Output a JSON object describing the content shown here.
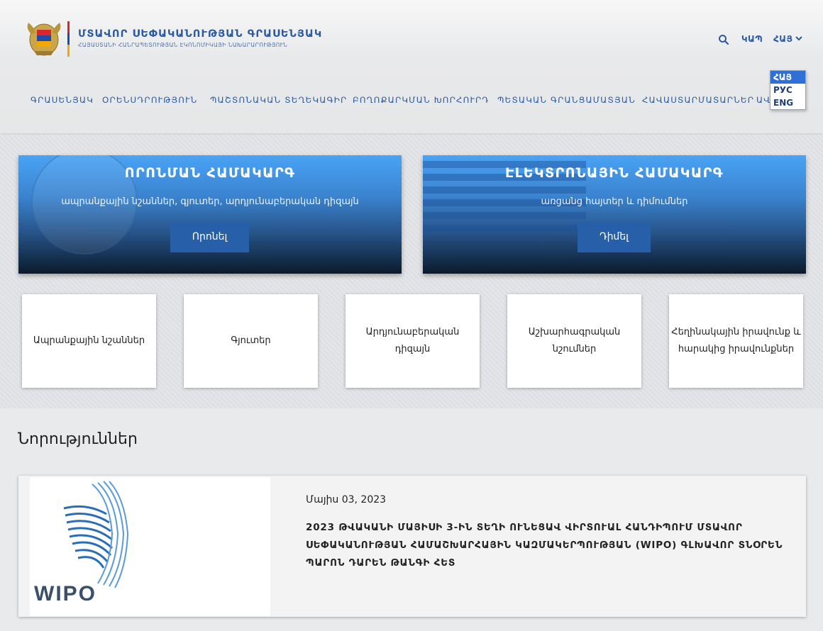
{
  "header": {
    "org_title": "ՄՏԱՎՈՐ ՍԵՓԱԿԱՆՈՒԹՅԱՆ ԳՐԱՍԵՆՅԱԿ",
    "org_subtitle": "ՀԱՅԱՍՏԱՆԻ ՀԱՆՐԱՊԵՏՈՒԹՅԱՆ ԷԿՈՆՈՄԻԿԱՅԻ ՆԱԽԱՐԱՐՈՒԹՅՈՒՆ",
    "kap_label": "ԿԱՊ",
    "lang_current": "ՀԱՅ"
  },
  "nav": {
    "items": [
      "ԳՐԱՍԵՆՅԱԿ",
      "ՕՐԵՆՍԴՐՈՒԹՅՈՒՆ",
      "ՊԱՇՏՈՆԱԿԱՆ ՏԵՂԵԿԱԳԻՐ",
      "ԲՈՂՈՔԱՐԿՄԱՆ ԽՈՐՀՈՒՐԴ",
      "ՊԵՏԱԿԱՆ ԳՐԱՆՑԱՄԱՏՅԱՆ",
      "ՀԱՎԱՍՏԱՐՄԱՏԱՐՆԵՐ",
      "ԱՎ"
    ]
  },
  "lang_dropdown": {
    "options": [
      "ՀԱՅ",
      "РУС",
      "ENG"
    ],
    "selected": "ՀԱՅ"
  },
  "promos": [
    {
      "title": "ՈՐՈՆՄԱՆ ՀԱՄԱԿԱՐԳ",
      "subtitle": "ապրանքային նշաններ, գյուտեր, արդյունաբերական դիզայն",
      "button": "Որոնել"
    },
    {
      "title": "ԷԼԵԿՏՐՈՆԱՅԻՆ ՀԱՄԱԿԱՐԳ",
      "subtitle": "առցանց հայտեր և դիմումներ",
      "button": "Դիմել"
    }
  ],
  "cards": [
    "Ապրանքային նշաններ",
    "Գյուտեր",
    "Արդյունաբերական դիզայն",
    "Աշխարհագրական նշումներ",
    "Հեղինակային իրավունք և հարակից իրավունքներ"
  ],
  "news": {
    "heading": "Նորություններ",
    "items": [
      {
        "date": "Մայիս 03, 2023",
        "title": "2023 ԹՎԱԿԱՆԻ ՄԱՅԻՍԻ 3-ԻՆ ՏԵՂԻ ՈՒՆԵՑԱՎ ՎԻՐՏՈՒԱԼ ՀԱՆԴԻՊՈՒՄ ՄՏԱՎՈՐ ՍԵՓԱԿԱՆՈՒԹՅԱՆ ՀԱՄԱՇԽԱՐՀԱՅԻՆ ԿԱԶՄԱԿԵՐՊՈՒԹՅԱՆ (WIPO) ԳԼԽԱՎՈՐ ՏՆՕՐԵՆ ՊԱՐՈՆ ԴԱՐԵՆ ԹԱՆԳԻ ՀԵՏ",
        "image_logo_text": "WIPO"
      }
    ]
  },
  "colors": {
    "brand_blue": "#2a5aa0",
    "button_blue": "#2760a8",
    "dropdown_active": "#2f6fd8"
  }
}
